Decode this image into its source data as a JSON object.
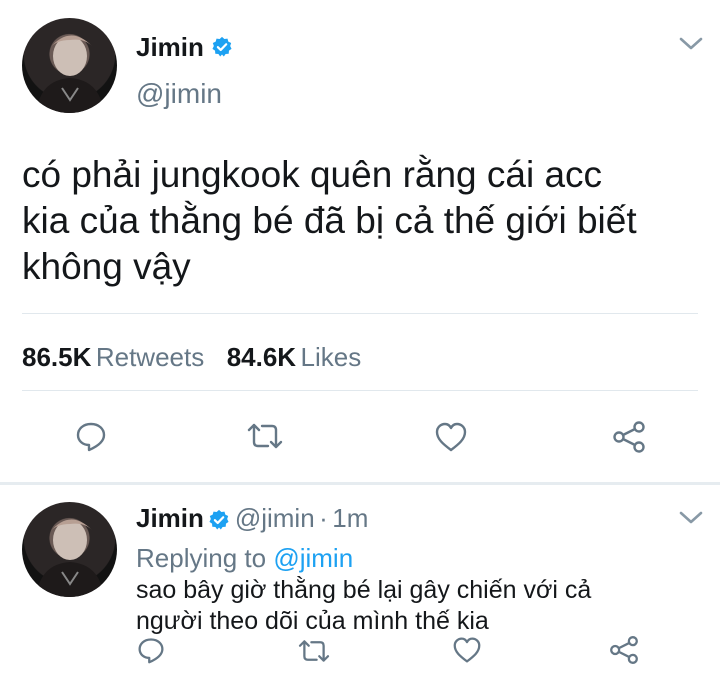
{
  "tweet": {
    "author_name": "Jimin",
    "author_handle": "@jimin",
    "text_lines": [
      "có phải jungkook quên rằng cái acc",
      "kia của thằng bé đã bị cả thế giới biết",
      "không vậy"
    ],
    "retweets_count": "86.5K",
    "retweets_label": "Retweets",
    "likes_count": "84.6K",
    "likes_label": "Likes"
  },
  "reply": {
    "author_name": "Jimin",
    "author_handle": "@jimin",
    "separator": "·",
    "time": "1m",
    "replying_prefix": "Replying to",
    "replying_handle": "@jimin",
    "text_lines": [
      "sao bây giờ thằng bé lại gây chiến với cả",
      "người theo dõi của mình thế kia"
    ]
  },
  "colors": {
    "verified": "#1da1f2",
    "secondary_text": "#657786",
    "link": "#1da1f2",
    "icon": "#657786"
  },
  "icons": [
    "verified-badge-icon",
    "chevron-down-icon",
    "reply-icon",
    "retweet-icon",
    "like-icon",
    "share-icon"
  ]
}
